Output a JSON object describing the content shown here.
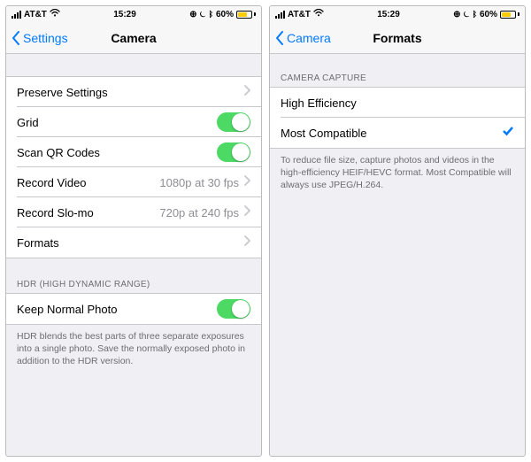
{
  "status": {
    "carrier": "AT&T",
    "time": "15:29",
    "battery_pct": "60%"
  },
  "left": {
    "back": "Settings",
    "title": "Camera",
    "rows": {
      "preserve": "Preserve Settings",
      "grid": "Grid",
      "scanqr": "Scan QR Codes",
      "record_video": "Record Video",
      "record_video_val": "1080p at 30 fps",
      "record_slomo": "Record Slo-mo",
      "record_slomo_val": "720p at 240 fps",
      "formats": "Formats"
    },
    "hdr_header": "HDR (HIGH DYNAMIC RANGE)",
    "keep_normal": "Keep Normal Photo",
    "hdr_footer": "HDR blends the best parts of three separate exposures into a single photo. Save the normally exposed photo in addition to the HDR version."
  },
  "right": {
    "back": "Camera",
    "title": "Formats",
    "section_header": "CAMERA CAPTURE",
    "high_eff": "High Efficiency",
    "most_compat": "Most Compatible",
    "footer": "To reduce file size, capture photos and videos in the high-efficiency HEIF/HEVC format. Most Compatible will always use JPEG/H.264."
  }
}
